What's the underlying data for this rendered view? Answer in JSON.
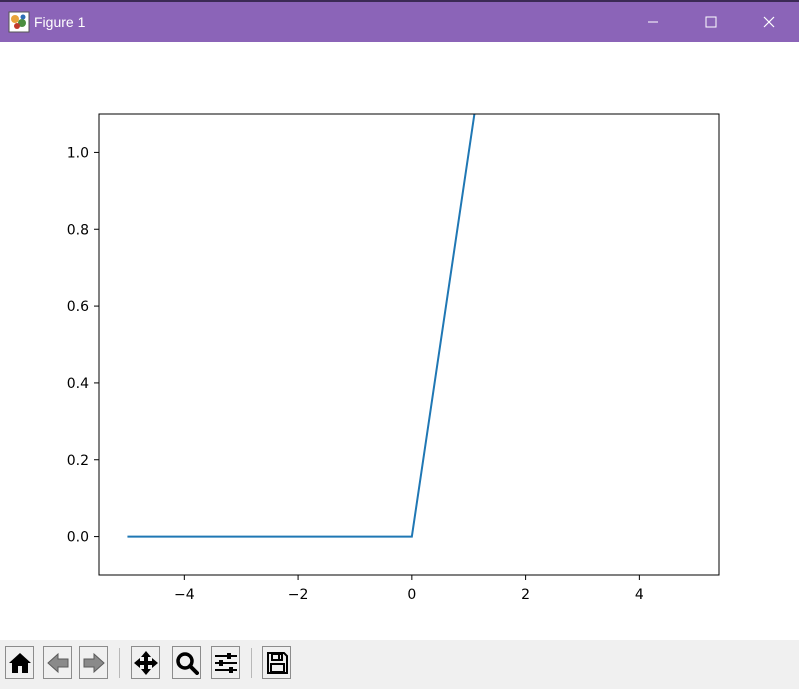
{
  "window": {
    "title": "Figure 1",
    "accent": "#8b64b8"
  },
  "icons": {
    "app": "matplotlib-figure-icon",
    "minimize": "minimize-icon",
    "maximize": "maximize-icon",
    "close": "close-icon"
  },
  "toolbar": {
    "buttons": [
      {
        "name": "home-button",
        "icon": "home-icon"
      },
      {
        "name": "back-button",
        "icon": "arrow-left-icon"
      },
      {
        "name": "forward-button",
        "icon": "arrow-right-icon"
      },
      {
        "name": "pan-button",
        "icon": "move-icon"
      },
      {
        "name": "zoom-button",
        "icon": "magnifier-icon"
      },
      {
        "name": "configure-subplots-button",
        "icon": "sliders-icon"
      },
      {
        "name": "save-button",
        "icon": "floppy-disk-icon"
      }
    ]
  },
  "chart_data": {
    "type": "line",
    "title": "",
    "xlabel": "",
    "ylabel": "",
    "xlim": [
      -5.5,
      5.4
    ],
    "ylim": [
      -0.1,
      1.1
    ],
    "xticks": [
      -4,
      -2,
      0,
      2,
      4
    ],
    "xtick_labels": [
      "−4",
      "−2",
      "0",
      "2",
      "4"
    ],
    "yticks": [
      0.0,
      0.2,
      0.4,
      0.6,
      0.8,
      1.0
    ],
    "ytick_labels": [
      "0.0",
      "0.2",
      "0.4",
      "0.6",
      "0.8",
      "1.0"
    ],
    "grid": false,
    "series": [
      {
        "color": "#1f77b4",
        "x": [
          -5.0,
          0.0,
          1.1
        ],
        "y": [
          0.0,
          0.0,
          1.1
        ]
      }
    ]
  }
}
